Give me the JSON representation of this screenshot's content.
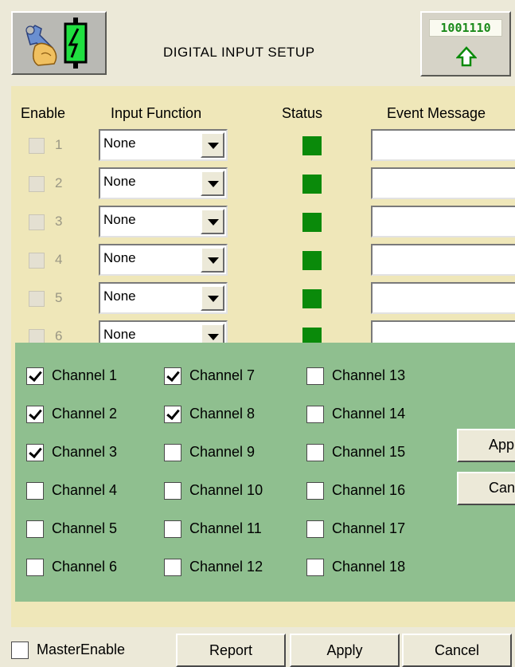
{
  "header": {
    "title": "DIGITAL INPUT SETUP",
    "binary_display": "1001110",
    "tool_icon": "wrench-and-switch-icon",
    "upload_icon": "up-arrow-icon"
  },
  "table": {
    "columns": [
      "Enable",
      "Input Function",
      "Status",
      "Event Message"
    ],
    "rows": [
      {
        "num": "1",
        "function": "None",
        "status": "active",
        "message": ""
      },
      {
        "num": "2",
        "function": "None",
        "status": "active",
        "message": ""
      },
      {
        "num": "3",
        "function": "None",
        "status": "active",
        "message": ""
      },
      {
        "num": "4",
        "function": "None",
        "status": "active",
        "message": ""
      },
      {
        "num": "5",
        "function": "None",
        "status": "active",
        "message": ""
      },
      {
        "num": "6",
        "function": "None",
        "status": "active",
        "message": ""
      }
    ],
    "status_color": "#0a8a0a"
  },
  "channel_popup": {
    "channels": [
      {
        "label": "Channel 1",
        "checked": true
      },
      {
        "label": "Channel 2",
        "checked": true
      },
      {
        "label": "Channel 3",
        "checked": true
      },
      {
        "label": "Channel 4",
        "checked": false
      },
      {
        "label": "Channel 5",
        "checked": false
      },
      {
        "label": "Channel 6",
        "checked": false
      },
      {
        "label": "Channel 7",
        "checked": true
      },
      {
        "label": "Channel 8",
        "checked": true
      },
      {
        "label": "Channel 9",
        "checked": false
      },
      {
        "label": "Channel 10",
        "checked": false
      },
      {
        "label": "Channel 11",
        "checked": false
      },
      {
        "label": "Channel 12",
        "checked": false
      },
      {
        "label": "Channel 13",
        "checked": false
      },
      {
        "label": "Channel 14",
        "checked": false
      },
      {
        "label": "Channel 15",
        "checked": false
      },
      {
        "label": "Channel 16",
        "checked": false
      },
      {
        "label": "Channel 17",
        "checked": false
      },
      {
        "label": "Channel 18",
        "checked": false
      }
    ],
    "apply_label": "App",
    "cancel_label": "Canc",
    "background": "#8fbf8f"
  },
  "footer": {
    "master_enable_label": "MasterEnable",
    "master_enable_checked": false,
    "report_label": "Report",
    "apply_label": "Apply",
    "cancel_label": "Cancel"
  }
}
